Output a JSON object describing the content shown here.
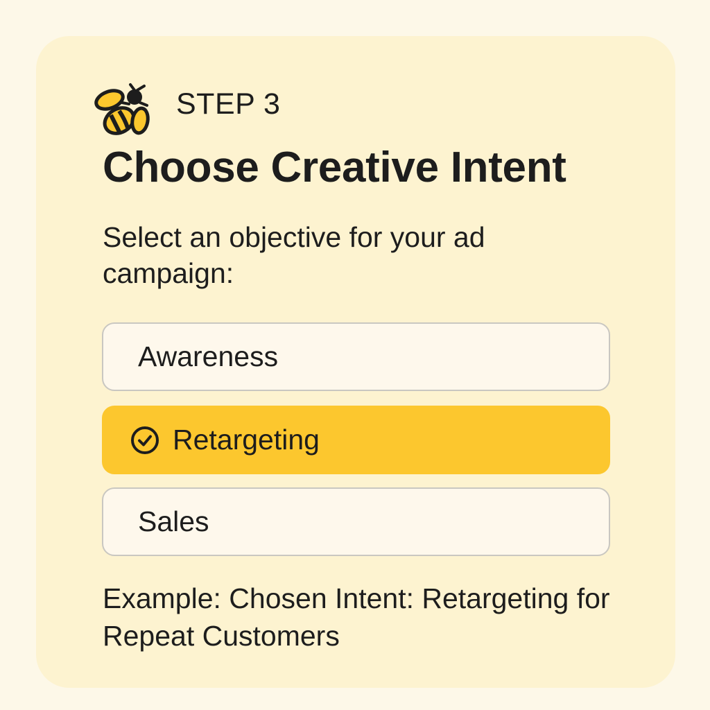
{
  "step": {
    "icon": "bee-icon",
    "label": "STEP 3"
  },
  "title": "Choose Creative Intent",
  "subtitle": "Select an objective for your ad campaign:",
  "options": [
    {
      "label": "Awareness",
      "selected": false
    },
    {
      "label": "Retargeting",
      "selected": true,
      "icon": "check-circle-icon"
    },
    {
      "label": "Sales",
      "selected": false
    }
  ],
  "example": "Example: Chosen Intent: Retargeting for Repeat Customers",
  "colors": {
    "page_background": "#FDF8E8",
    "card_background": "#FDF3D0",
    "accent": "#FCC72E",
    "text": "#1D1D1D",
    "option_border": "#C9C7C1"
  }
}
